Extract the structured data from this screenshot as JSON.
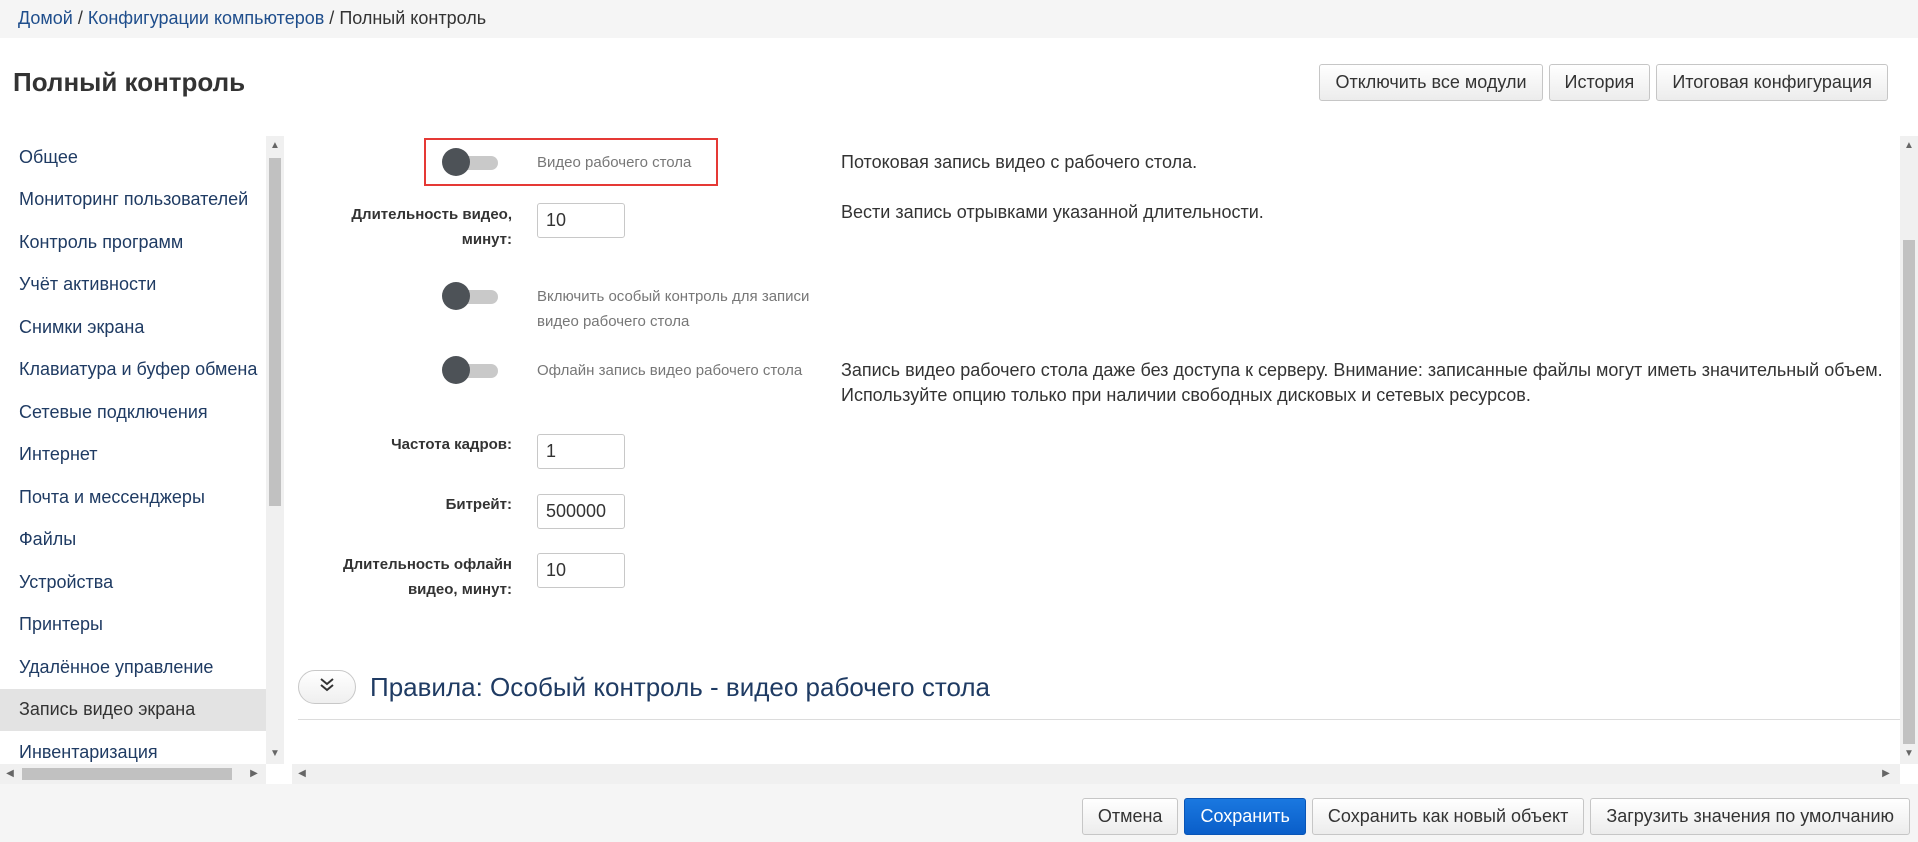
{
  "breadcrumb": {
    "items": [
      "Домой",
      "Конфигурации компьютеров",
      "Полный контроль"
    ],
    "separator": "/"
  },
  "page": {
    "title": "Полный контроль"
  },
  "header_actions": {
    "disable_all": "Отключить все модули",
    "history": "История",
    "final_config": "Итоговая конфигурация"
  },
  "sidebar": {
    "items": [
      {
        "label": "Общее"
      },
      {
        "label": "Мониторинг пользователей"
      },
      {
        "label": "Контроль программ"
      },
      {
        "label": "Учёт активности"
      },
      {
        "label": "Снимки экрана"
      },
      {
        "label": "Клавиатура и буфер обмена"
      },
      {
        "label": "Сетевые подключения"
      },
      {
        "label": "Интернет"
      },
      {
        "label": "Почта и мессенджеры"
      },
      {
        "label": "Файлы"
      },
      {
        "label": "Устройства"
      },
      {
        "label": "Принтеры"
      },
      {
        "label": "Удалённое управление"
      },
      {
        "label": "Запись видео экрана",
        "active": true
      },
      {
        "label": "Инвентаризация"
      }
    ]
  },
  "settings": {
    "desktop_video": {
      "label": "Видео рабочего стола",
      "enabled": false,
      "description": "Потоковая запись видео с рабочего стола."
    },
    "video_duration": {
      "label_line1": "Длительность видео,",
      "label_line2": "минут:",
      "value": "10",
      "description": "Вести запись отрывками указанной длительности."
    },
    "special_control": {
      "label_line1": "Включить особый контроль для записи",
      "label_line2": "видео рабочего стола",
      "enabled": false
    },
    "offline_record": {
      "label": "Офлайн запись видео рабочего стола",
      "enabled": false,
      "description_line1": "Запись видео рабочего стола даже без доступа к серверу. Внимание: записанные файлы могут иметь значительный объем.",
      "description_line2": "Используйте опцию только при наличии свободных дисковых и сетевых ресурсов."
    },
    "frame_rate": {
      "label": "Частота кадров:",
      "value": "1"
    },
    "bitrate": {
      "label": "Битрейт:",
      "value": "500000"
    },
    "offline_duration": {
      "label_line1": "Длительность офлайн",
      "label_line2": "видео, минут:",
      "value": "10"
    }
  },
  "rules": {
    "title": "Правила: Особый контроль - видео рабочего стола",
    "expand_icon": "double-chevron-down"
  },
  "footer_actions": {
    "cancel": "Отмена",
    "save": "Сохранить",
    "save_as_new": "Сохранить как новый объект",
    "load_defaults": "Загрузить значения по умолчанию"
  },
  "colors": {
    "link": "#1f4e8c",
    "primary": "#0a5ec9",
    "highlight": "#e53935",
    "active_sidebar": "#e3e3e3"
  }
}
